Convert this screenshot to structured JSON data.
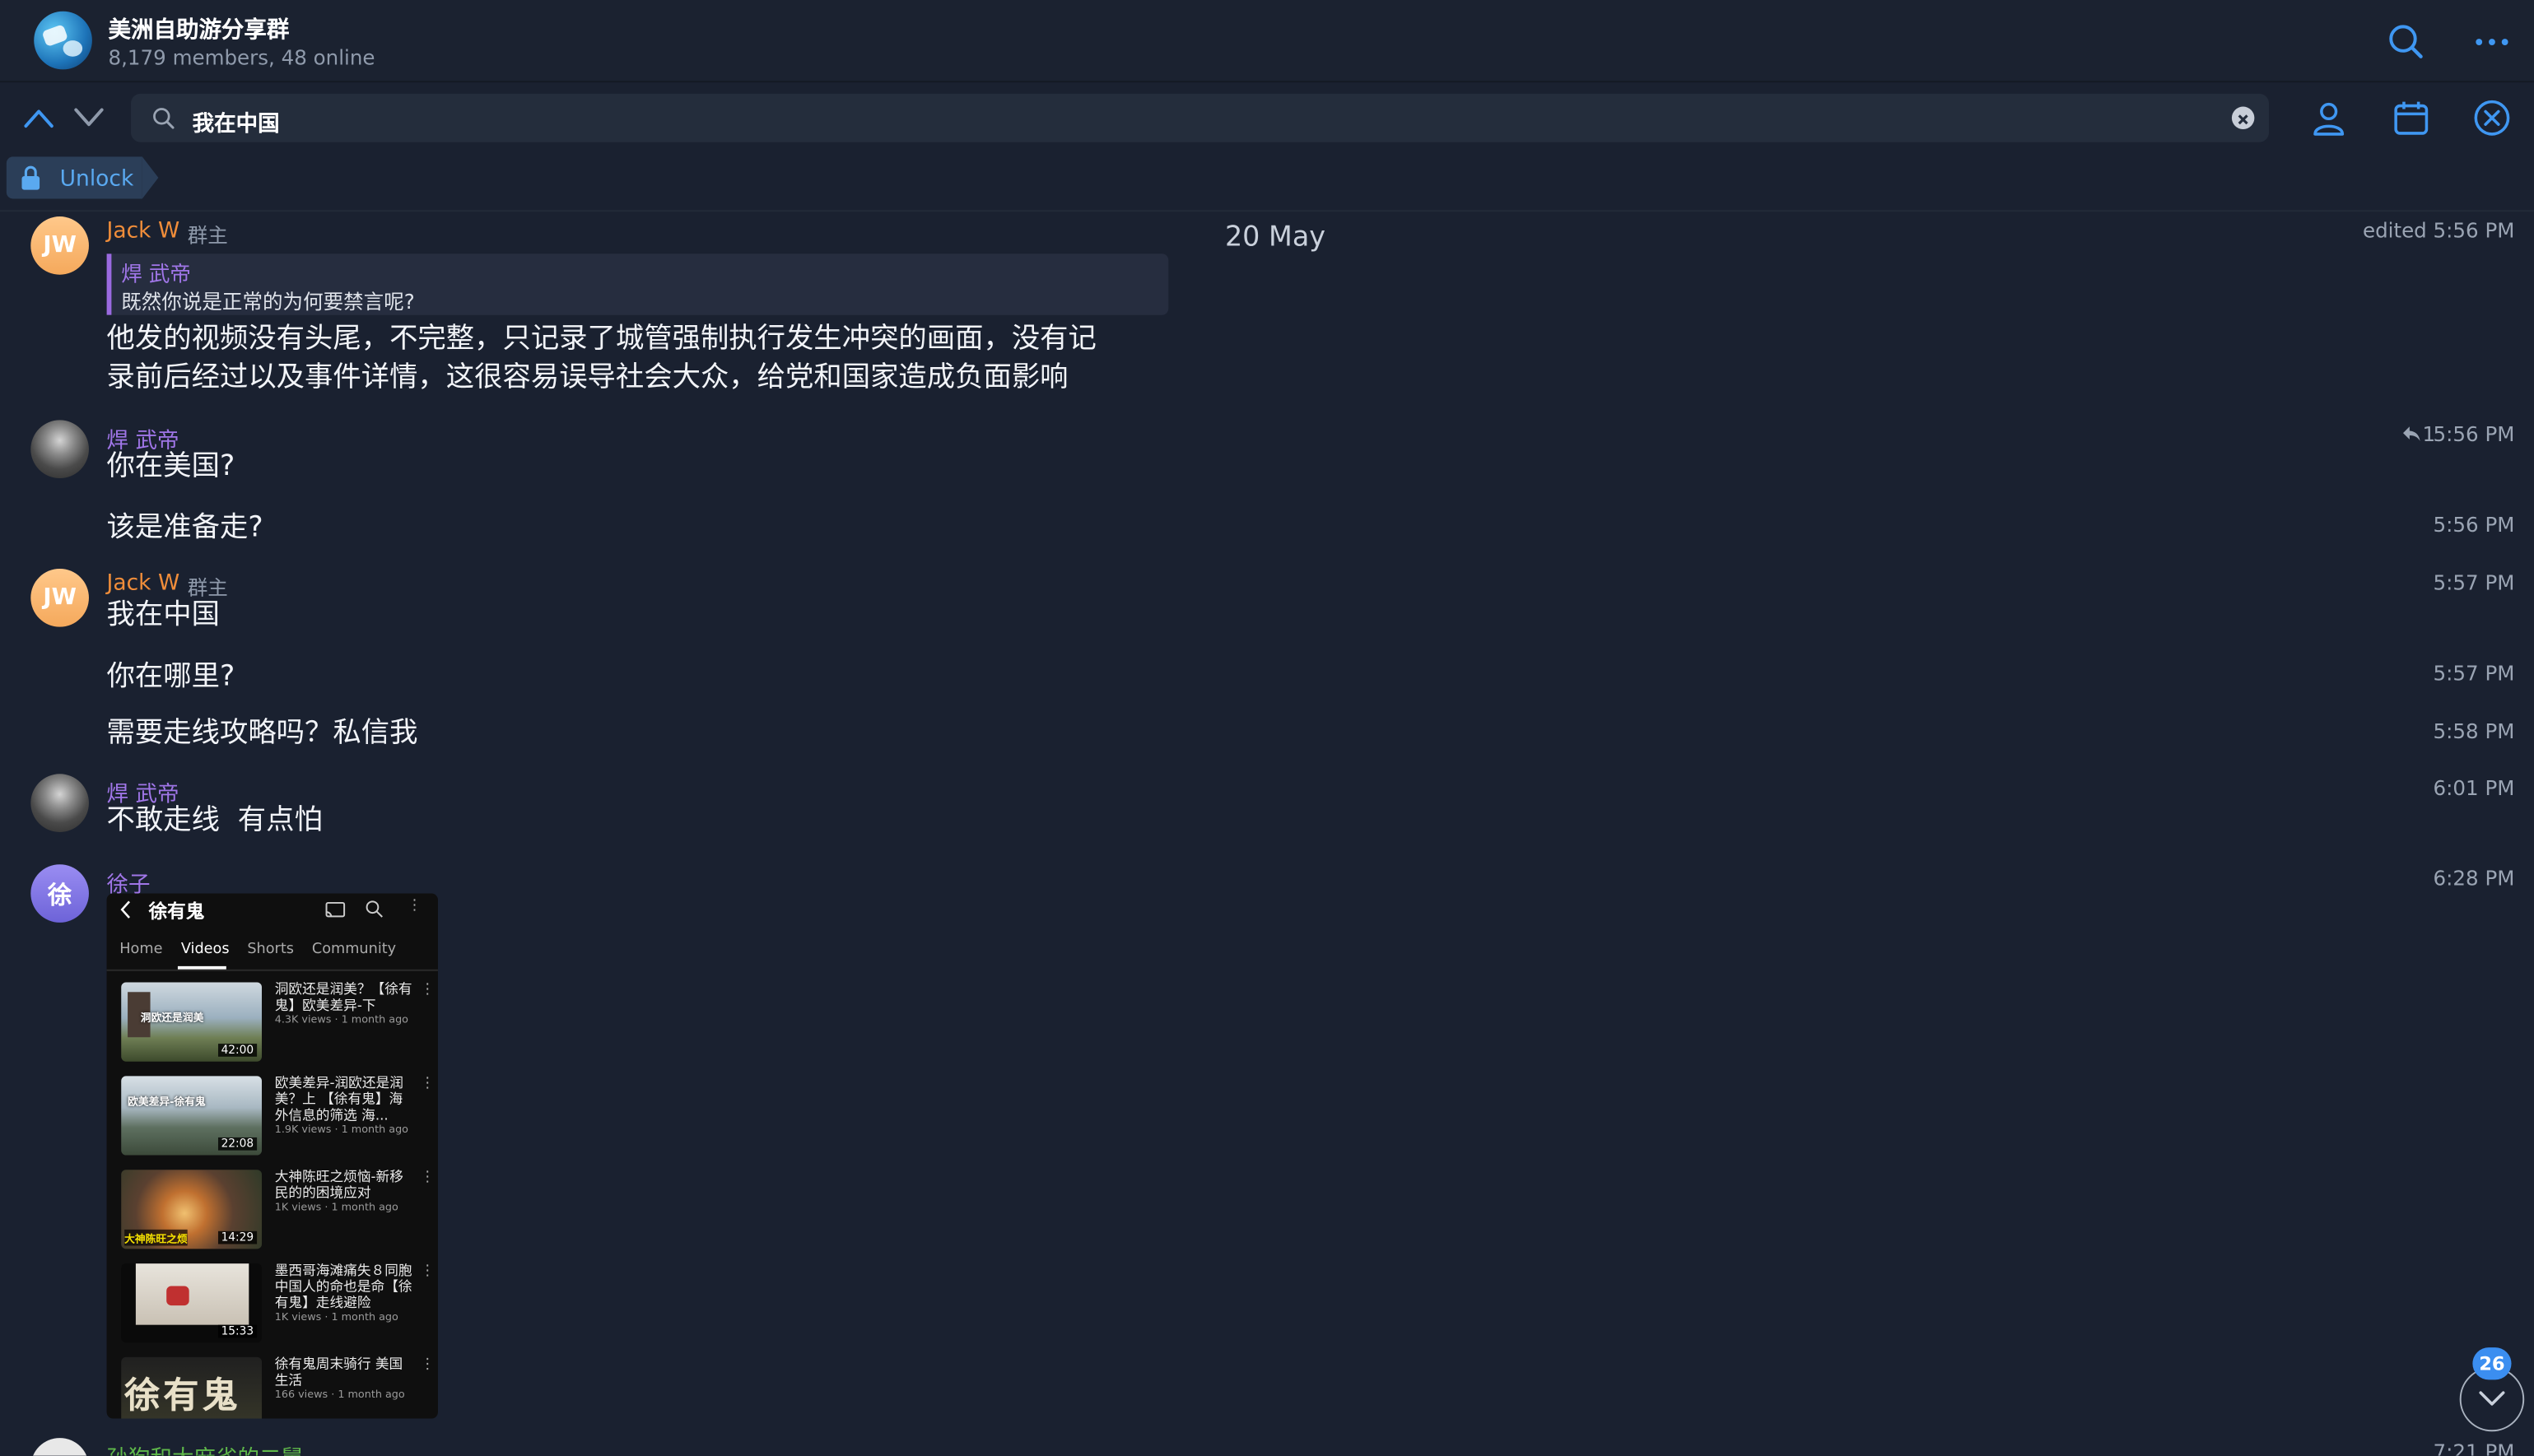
{
  "header": {
    "title": "美洲自助游分享群",
    "subtitle": "8,179 members, 48 online"
  },
  "search": {
    "query": "我在中国",
    "unlock_label": "Unlock"
  },
  "date_label": "20 May",
  "messages": [
    {
      "sender": "Jack W",
      "avatar_initials": "JW",
      "role": "群主",
      "time": "edited 5:56 PM",
      "reply_to": {
        "sender": "焊 武帝",
        "text": "既然你说是正常的为何要禁言呢?"
      },
      "text_line1": "他发的视频没有头尾，不完整，只记录了城管强制执行发生冲突的画面，没有记",
      "text_line2": "录前后经过以及事件详情，这很容易误导社会大众，给党和国家造成负面影响"
    },
    {
      "sender": "焊 武帝",
      "text": "你在美国?",
      "time": "5:56 PM",
      "reply_count": "1"
    },
    {
      "text": "该是准备走?",
      "time": "5:56 PM"
    },
    {
      "sender": "Jack W",
      "avatar_initials": "JW",
      "role": "群主",
      "text": "我在中国",
      "time": "5:57 PM"
    },
    {
      "text": "你在哪里?",
      "time": "5:57 PM"
    },
    {
      "text": "需要走线攻略吗？私信我",
      "time": "5:58 PM"
    },
    {
      "sender": "焊 武帝",
      "text": "不敢走线  有点怕",
      "time": "6:01 PM"
    },
    {
      "sender": "徐子",
      "avatar_initials": "徐",
      "time": "6:28 PM"
    },
    {
      "sender": "孙狗和大麻雀的二舅",
      "time": "7:21 PM"
    }
  ],
  "screenshot": {
    "channel": "徐有鬼",
    "tabs": [
      "Home",
      "Videos",
      "Shorts",
      "Community"
    ],
    "videos": [
      {
        "title": "洞欧还是润美？【徐有鬼】欧美差异-下",
        "meta": "4.3K views · 1 month ago",
        "duration": "42:00",
        "thumb_text": "洞欧还是润美"
      },
      {
        "title": "欧美差异-润欧还是润美？上 【徐有鬼】海外信息的筛选 海...",
        "meta": "1.9K views · 1 month ago",
        "duration": "22:08",
        "thumb_text": "欧美差异-徐有鬼"
      },
      {
        "title": "大神陈旺之烦恼-新移民的的困境应对",
        "meta": "1K views · 1 month ago",
        "duration": "14:29",
        "thumb_text": "大神陈旺之烦"
      },
      {
        "title": "墨西哥海滩痛失８同胞 中国人的命也是命【徐有鬼】走线避险",
        "meta": "1K views · 1 month ago",
        "duration": "15:33",
        "thumb_text": ""
      },
      {
        "title": "徐有鬼周末骑行 美国生活",
        "meta": "166 views · 1 month ago",
        "duration": "",
        "thumb_text": "徐有鬼"
      }
    ]
  },
  "unread_badge": "26"
}
